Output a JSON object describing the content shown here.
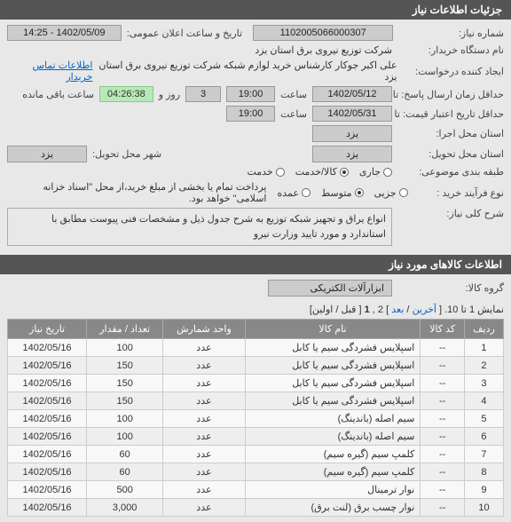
{
  "sections": {
    "info_title": "جزئیات اطلاعات نیاز",
    "items_title": "اطلاعات کالاهای مورد نیاز"
  },
  "fields": {
    "need_no_label": "شماره نیاز:",
    "need_no": "1102005066000307",
    "pub_datetime_label": "تاریخ و ساعت اعلان عمومی:",
    "pub_datetime": "1402/05/09 - 14:25",
    "org_label": "نام دستگاه خریدار:",
    "org": "شرکت توزیع نیروی برق استان یزد",
    "requester_label": "ایجاد کننده درخواست:",
    "requester": "علی اکبر جوکار  کارشناس خرید لوازم شبکه  شرکت توزیع نیروی برق استان یزد",
    "contact_link": "اطلاعات تماس خریدار",
    "deadline_label": "حداقل زمان ارسال پاسخ:  تا تاریخ:",
    "deadline_date": "1402/05/12",
    "deadline_time_label": "ساعت",
    "deadline_time": "19:00",
    "day_unit": "روز و",
    "days_left": "3",
    "remain_label": "ساعت باقی مانده",
    "timer": "04:26:38",
    "price_valid_label": "حداقل تاریخ اعتبار قیمت: تا تاریخ:",
    "price_valid_date": "1402/05/31",
    "price_valid_time": "19:00",
    "exec_state_label": "استان محل اجرا:",
    "exec_state": "یزد",
    "deliv_state_label": "استان محل تحویل:",
    "deliv_city_label": "شهر محل تحویل:",
    "deliv_state": "یزد",
    "deliv_city": "یزد",
    "budget_label": "طبقه بندی موضوعی:",
    "purchase_type_label": "نوع فرآیند خرید :",
    "pay_note": "پرداخت تمام یا بخشی از مبلغ خرید،از محل \"اسناد خزانه اسلامی\" خواهد بود.",
    "main_desc_label": "شرح کلی نیاز:",
    "main_desc": "انواع یراق و تجهیز شبکه توزیع به شرح جدول ذیل و مشخصات فنی پیوست مطابق با استاندارد و مورد تایید وزارت نیرو",
    "group_label": "گروه کالا:",
    "group": "ابزارآلات الکتریکی"
  },
  "budget_options": {
    "o1": "جاری",
    "o2": "کالا/خدمت",
    "o3": "خدمت"
  },
  "purchase_options": {
    "o1": "جزیی",
    "o2": "متوسط",
    "o3": "عمده"
  },
  "pager": {
    "text_a": "نمایش 1 تا 10. [ ",
    "last": "آخرین",
    "sep": " / ",
    "next": "بعد",
    "text_b": " ] 2 ,",
    "cur": "1",
    "text_c": " [ قبل / اولین]"
  },
  "table": {
    "h1": "ردیف",
    "h2": "کد کالا",
    "h3": "نام کالا",
    "h4": "واحد شمارش",
    "h5": "تعداد / مقدار",
    "h6": "تاریخ نیاز",
    "rows": [
      {
        "i": "1",
        "code": "--",
        "name": "اسپلایس فشردگی سیم یا کابل",
        "unit": "عدد",
        "qty": "100",
        "date": "1402/05/16"
      },
      {
        "i": "2",
        "code": "--",
        "name": "اسپلایس فشردگی سیم یا کابل",
        "unit": "عدد",
        "qty": "150",
        "date": "1402/05/16"
      },
      {
        "i": "3",
        "code": "--",
        "name": "اسپلایس فشردگی سیم یا کابل",
        "unit": "عدد",
        "qty": "150",
        "date": "1402/05/16"
      },
      {
        "i": "4",
        "code": "--",
        "name": "اسپلایس فشردگی سیم یا کابل",
        "unit": "عدد",
        "qty": "150",
        "date": "1402/05/16"
      },
      {
        "i": "5",
        "code": "--",
        "name": "سیم اصله (باندینگ)",
        "unit": "عدد",
        "qty": "100",
        "date": "1402/05/16"
      },
      {
        "i": "6",
        "code": "--",
        "name": "سیم اصله (باندینگ)",
        "unit": "عدد",
        "qty": "100",
        "date": "1402/05/16"
      },
      {
        "i": "7",
        "code": "--",
        "name": "کلمپ سیم (گیره سیم)",
        "unit": "عدد",
        "qty": "60",
        "date": "1402/05/16"
      },
      {
        "i": "8",
        "code": "--",
        "name": "کلمپ سیم (گیره سیم)",
        "unit": "عدد",
        "qty": "60",
        "date": "1402/05/16"
      },
      {
        "i": "9",
        "code": "--",
        "name": "نوار ترمینال",
        "unit": "عدد",
        "qty": "500",
        "date": "1402/05/16"
      },
      {
        "i": "10",
        "code": "--",
        "name": "نوار چسب برق (لنت برق)",
        "unit": "عدد",
        "qty": "3,000",
        "date": "1402/05/16"
      }
    ]
  }
}
